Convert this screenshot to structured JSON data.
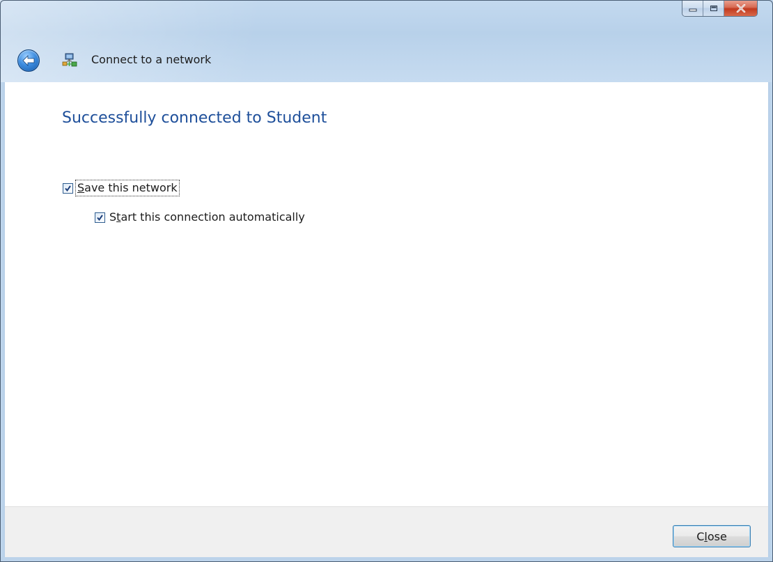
{
  "window": {
    "title": "Connect to a network",
    "caption_buttons": [
      "minimize",
      "maximize",
      "close"
    ]
  },
  "main": {
    "heading": "Successfully connected to Student",
    "checkboxes": [
      {
        "mnemonic": "S",
        "rest": "ave this network",
        "checked": true
      },
      {
        "before": "S",
        "mnemonic": "t",
        "rest": "art this connection automatically",
        "checked": true
      }
    ]
  },
  "footer": {
    "close_before": "C",
    "close_mnemonic": "l",
    "close_after": "ose"
  },
  "colors": {
    "heading": "#1e4f9a",
    "frame": "#c3d9ef",
    "footer_bg": "#f0f0f0"
  },
  "icons": {
    "back": "back-arrow-icon",
    "network": "network-connection-icon",
    "minimize": "minimize-icon",
    "maximize": "maximize-icon",
    "close": "close-icon",
    "check": "checkmark-icon"
  }
}
